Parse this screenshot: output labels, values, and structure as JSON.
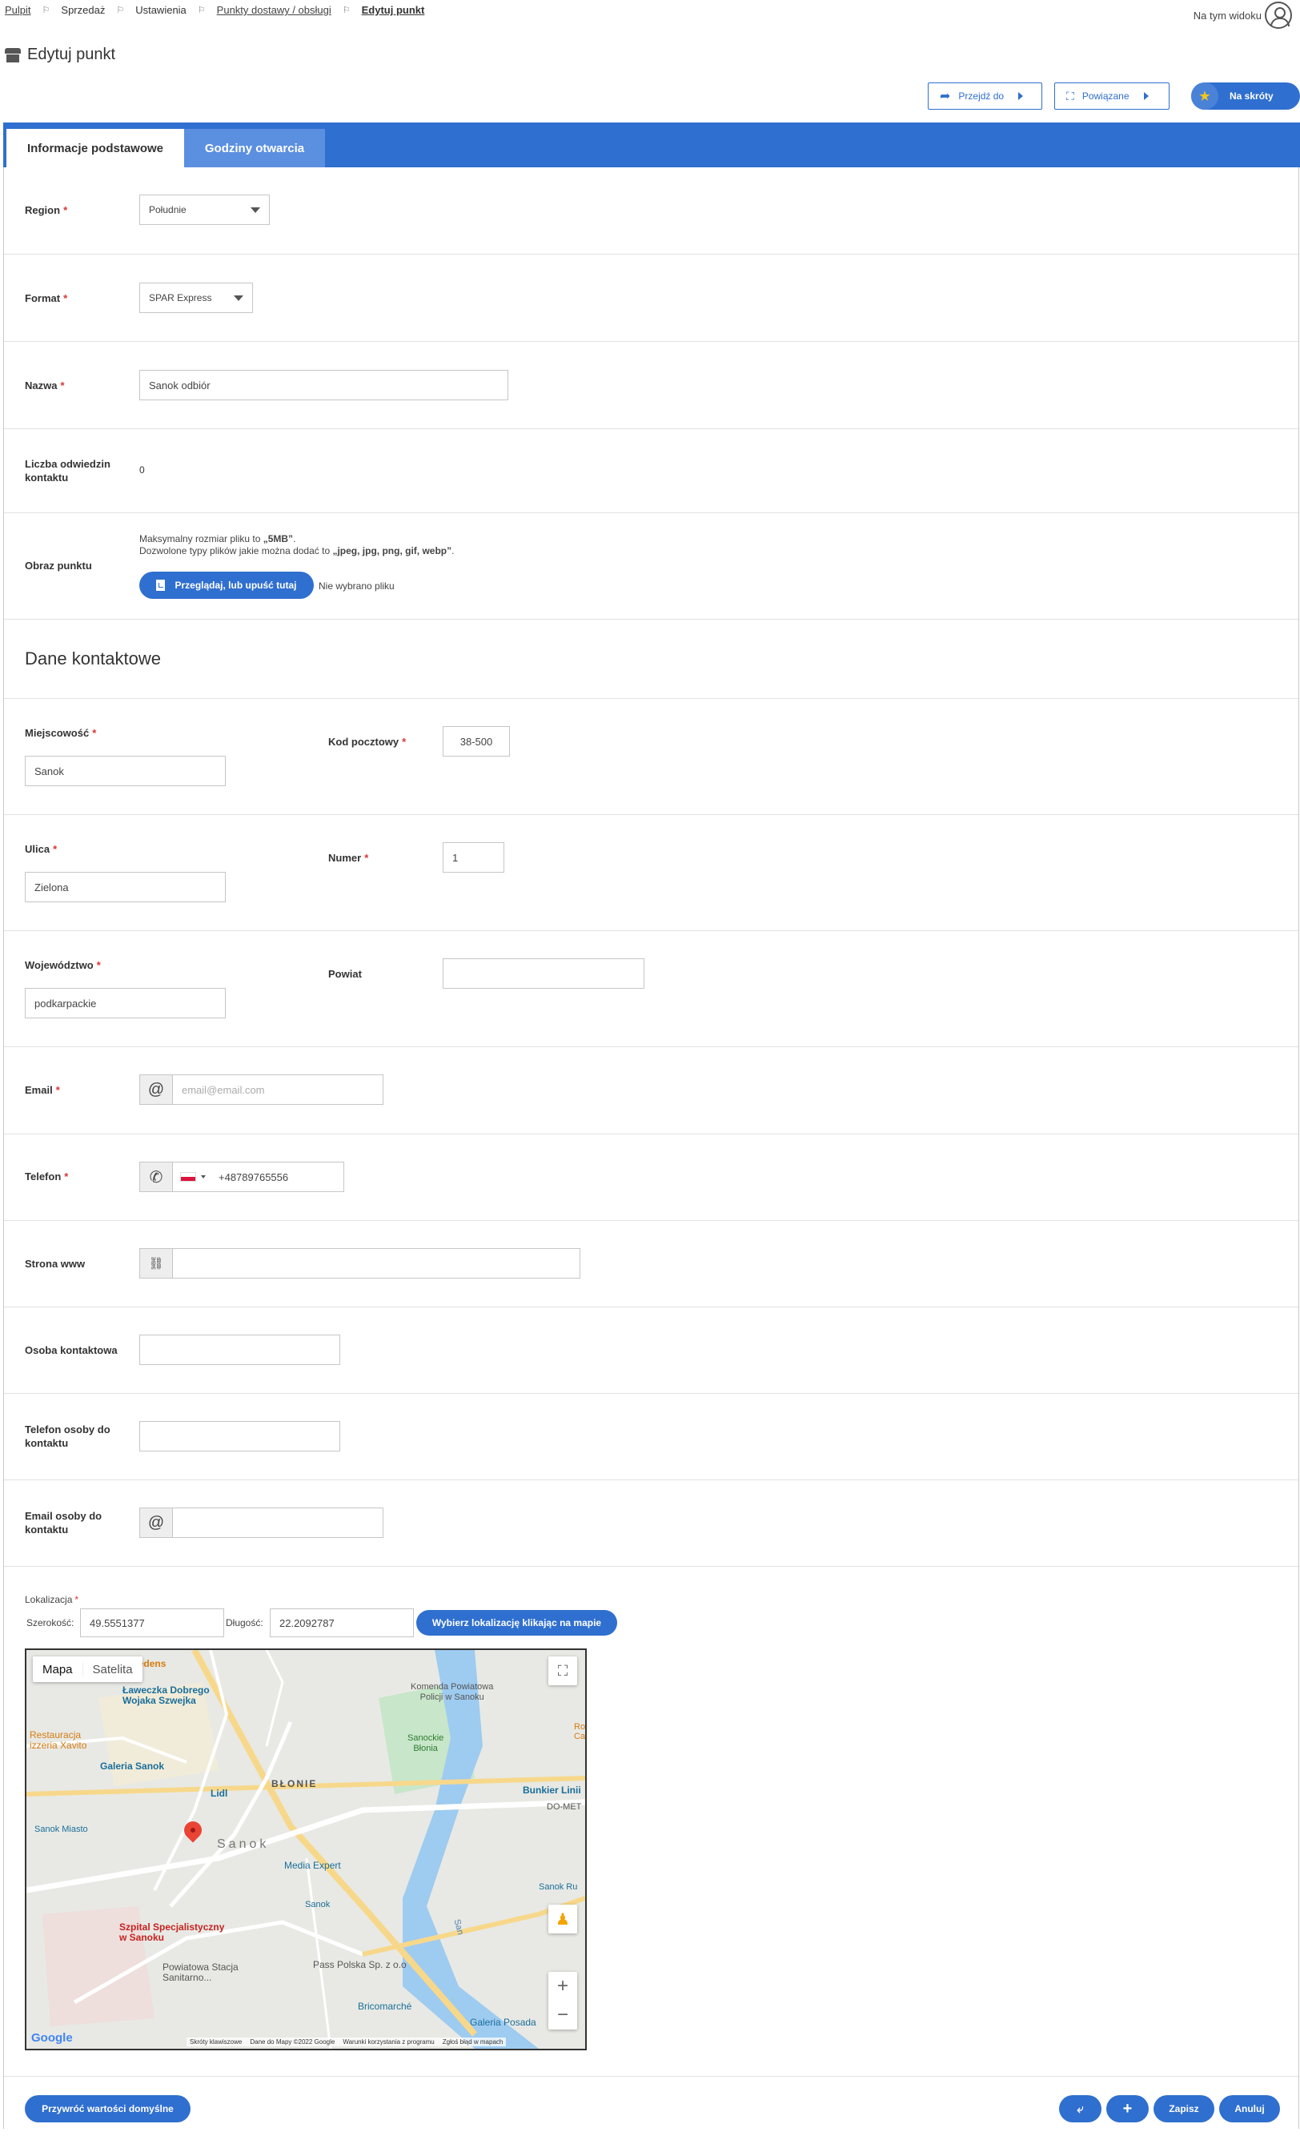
{
  "breadcrumb": [
    "Pulpit",
    "Sprzedaż",
    "Ustawienia",
    "Punkty dostawy / obsługi",
    "Edytuj punkt"
  ],
  "top_right": {
    "view_label": "Na tym widoku"
  },
  "page_title": "Edytuj punkt",
  "actions": {
    "goto": "Przejdź do",
    "related": "Powiązane",
    "shortcuts": "Na skróty"
  },
  "tabs": [
    "Informacje podstawowe",
    "Godziny otwarcia"
  ],
  "form": {
    "region": {
      "label": "Region",
      "value": "Południe"
    },
    "format": {
      "label": "Format",
      "value": "SPAR Express"
    },
    "nazwa": {
      "label": "Nazwa",
      "value": "Sanok odbiór"
    },
    "liczba": {
      "label_line1": "Liczba odwiedzin",
      "label_line2": "kontaktu",
      "value": "0"
    },
    "obraz": {
      "label": "Obraz punktu",
      "info_line1_prefix": "Maksymalny rozmiar pliku to ",
      "info_line1_bold": "„5MB”",
      "info_line1_suffix": ".",
      "info_line2_prefix": "Dozwolone typy plików jakie można dodać to ",
      "info_line2_bold": "„jpeg, jpg, png, gif, webp”",
      "info_line2_suffix": ".",
      "button": "Przeglądaj, lub upuść tutaj",
      "no_file": "Nie wybrano pliku"
    }
  },
  "contact": {
    "title": "Dane kontaktowe",
    "miejscowosc": {
      "label": "Miejscowość",
      "value": "Sanok"
    },
    "kod": {
      "label": "Kod pocztowy",
      "value": "38-500"
    },
    "ulica": {
      "label": "Ulica",
      "value": "Zielona"
    },
    "numer": {
      "label": "Numer",
      "value": "1"
    },
    "wojewodztwo": {
      "label": "Województwo",
      "value": "podkarpackie"
    },
    "powiat": {
      "label": "Powiat",
      "value": ""
    },
    "email": {
      "label": "Email",
      "placeholder": "email@email.com",
      "addon": "@"
    },
    "telefon": {
      "label": "Telefon",
      "value": "+48789765556"
    },
    "www": {
      "label": "Strona www",
      "value": ""
    },
    "osoba": {
      "label": "Osoba kontaktowa",
      "value": ""
    },
    "tel_osoby": {
      "label_line1": "Telefon osoby do",
      "label_line2": "kontaktu",
      "value": ""
    },
    "email_osoby": {
      "label_line1": "Email osoby do",
      "label_line2": "kontaktu",
      "addon": "@",
      "value": ""
    }
  },
  "location": {
    "label": "Lokalizacja",
    "lat_label": "Szerokość:",
    "lat": "49.5551377",
    "lng_label": "Długość:",
    "lng": "22.2092787",
    "pick_button": "Wybierz lokalizację klikając na mapie"
  },
  "map": {
    "tab_map": "Mapa",
    "tab_sat": "Satelita",
    "places": [
      "ary Kredens",
      "Ławeczka Dobrego",
      "Wojaka Szwejka",
      "Restauracja",
      "izzeria Xavito",
      "Galeria Sanok",
      "BŁONIE",
      "Lidl",
      "Sanok Miasto",
      "Sanok",
      "Media Expert",
      "Sanok",
      "Szpital Specjalistyczny",
      "w Sanoku",
      "Powiatowa Stacja",
      "Sanitarno...",
      "Pass Polska Sp. z o.o",
      "Bricomarché",
      "Galeria Posada",
      "Komenda Powiatowa",
      "Policji w Sanoku",
      "Sanockie",
      "Błonia",
      "Bunkier Linii",
      "DO-MET",
      "Sanok Ru",
      "San",
      "Ro",
      "Ca"
    ],
    "footer": [
      "Skróty klawiszowe",
      "Dane do Mapy ©2022 Google",
      "Warunki korzystania z programu",
      "Zgłoś błąd w mapach"
    ],
    "logo": "Google"
  },
  "footer": {
    "restore": "Przywróć wartości domyślne",
    "save": "Zapisz",
    "cancel": "Anuluj"
  },
  "colors": {
    "accent": "#2f6fcf",
    "required": "#dd3333"
  }
}
